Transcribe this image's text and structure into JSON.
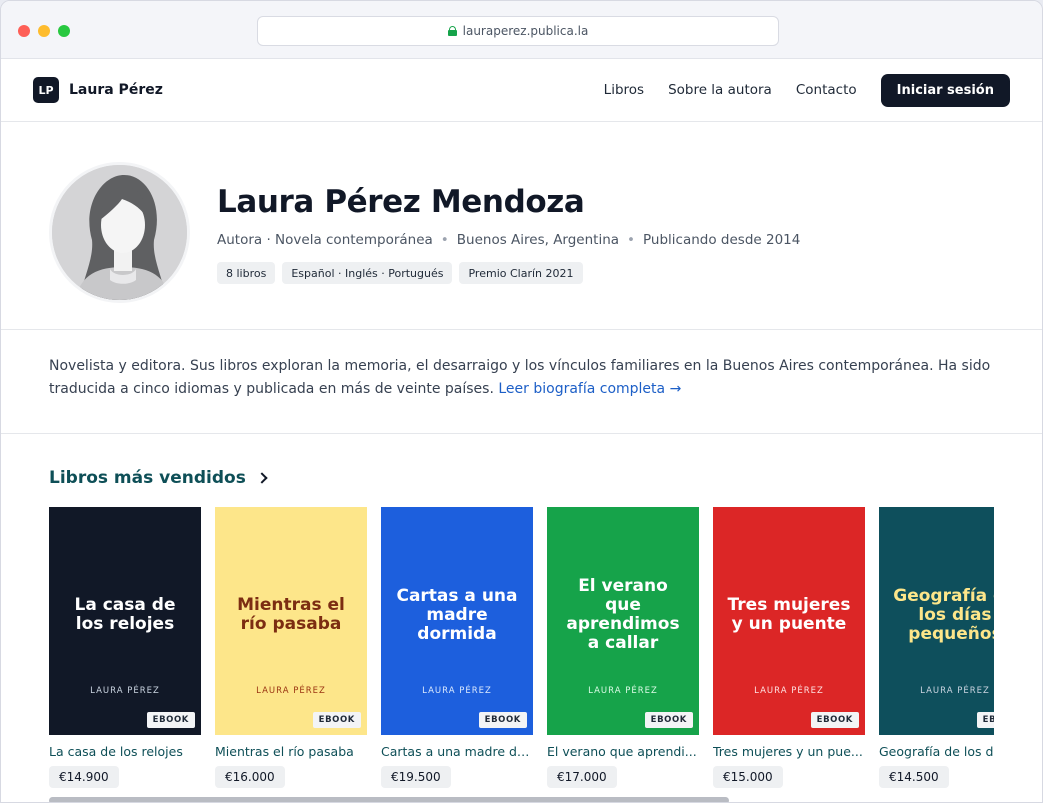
{
  "browser": {
    "url": "lauraperez.publica.la"
  },
  "header": {
    "logo_text": "LP",
    "brand_name": "Laura Pérez",
    "nav": [
      "Libros",
      "Sobre la autora",
      "Contacto"
    ],
    "login_label": "Iniciar sesión"
  },
  "profile": {
    "name": "Laura Pérez Mendoza",
    "meta": [
      "Autora · Novela contemporánea",
      "Buenos Aires, Argentina",
      "Publicando desde 2014"
    ],
    "tags": [
      "8 libros",
      "Español · Inglés · Portugués",
      "Premio Clarín 2021"
    ]
  },
  "bio": {
    "text": "Novelista y editora. Sus libros exploran la memoria, el desarraigo y los vínculos familiares en la Buenos Aires contemporánea. Ha sido traducida a cinco idiomas y publicada en más de veinte países. ",
    "link": "Leer biografía completa →"
  },
  "bestsellers": {
    "title": "Libros más vendidos",
    "books": [
      {
        "cover_title": "La casa de los relojes",
        "author": "LAURA PÉREZ",
        "badge": "EBOOK",
        "title": "La casa de los relojes",
        "price": "€14.900",
        "bg": "#111827",
        "fg": "#ffffff",
        "author_color": "#cbd5e1"
      },
      {
        "cover_title": "Mientras el río pasaba",
        "author": "LAURA PÉREZ",
        "badge": "EBOOK",
        "title": "Mientras el río pasaba",
        "price": "€16.000",
        "bg": "#fde68a",
        "fg": "#7c2d12",
        "author_color": "#9a3412"
      },
      {
        "cover_title": "Cartas a una madre dormida",
        "author": "LAURA PÉREZ",
        "badge": "EBOOK",
        "title": "Cartas a una madre do...",
        "price": "€19.500",
        "bg": "#1d5fdd",
        "fg": "#ffffff",
        "author_color": "#dbeafe"
      },
      {
        "cover_title": "El verano que aprendimos a callar",
        "author": "LAURA PÉREZ",
        "badge": "EBOOK",
        "title": "El verano que aprendi...",
        "price": "€17.000",
        "bg": "#16a34a",
        "fg": "#ffffff",
        "author_color": "#dcfce7"
      },
      {
        "cover_title": "Tres mujeres y un puente",
        "author": "LAURA PÉREZ",
        "badge": "EBOOK",
        "title": "Tres mujeres y un pue...",
        "price": "€15.000",
        "bg": "#dc2626",
        "fg": "#ffffff",
        "author_color": "#fee2e2"
      },
      {
        "cover_title": "Geografía de los días pequeños",
        "author": "LAURA PÉREZ",
        "badge": "EBOOK",
        "title": "Geografía de los días pequeños",
        "price": "€14.500",
        "bg": "#0e4f5c",
        "fg": "#fde68a",
        "author_color": "#cbd5e1"
      }
    ]
  }
}
